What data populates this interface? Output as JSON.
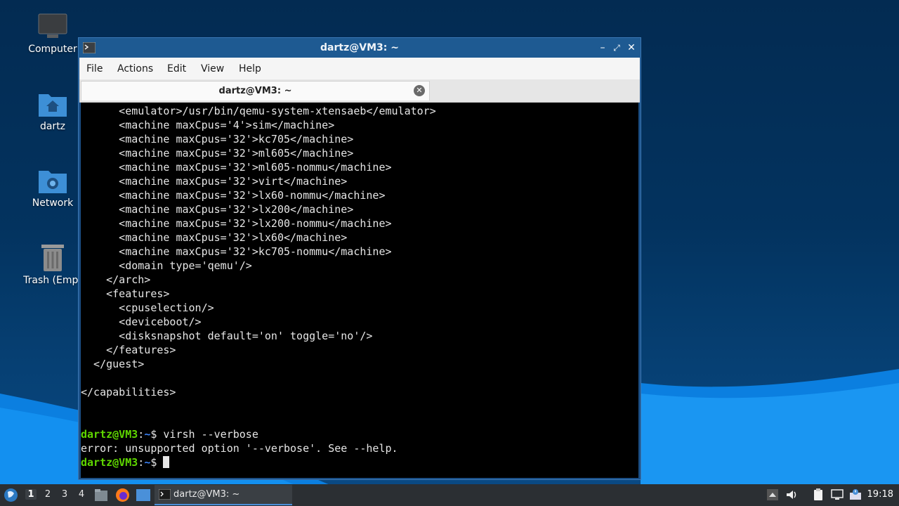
{
  "desktop": {
    "icons": [
      {
        "label": "Computer"
      },
      {
        "label": "dartz"
      },
      {
        "label": "Network"
      },
      {
        "label": "Trash (Empt"
      }
    ]
  },
  "window": {
    "title": "dartz@VM3: ~",
    "menu": [
      "File",
      "Actions",
      "Edit",
      "View",
      "Help"
    ],
    "tab_title": "dartz@VM3: ~"
  },
  "terminal": {
    "lines": [
      "      <emulator>/usr/bin/qemu-system-xtensaeb</emulator>",
      "      <machine maxCpus='4'>sim</machine>",
      "      <machine maxCpus='32'>kc705</machine>",
      "      <machine maxCpus='32'>ml605</machine>",
      "      <machine maxCpus='32'>ml605-nommu</machine>",
      "      <machine maxCpus='32'>virt</machine>",
      "      <machine maxCpus='32'>lx60-nommu</machine>",
      "      <machine maxCpus='32'>lx200</machine>",
      "      <machine maxCpus='32'>lx200-nommu</machine>",
      "      <machine maxCpus='32'>lx60</machine>",
      "      <machine maxCpus='32'>kc705-nommu</machine>",
      "      <domain type='qemu'/>",
      "    </arch>",
      "    <features>",
      "      <cpuselection/>",
      "      <deviceboot/>",
      "      <disksnapshot default='on' toggle='no'/>",
      "    </features>",
      "  </guest>",
      "",
      "</capabilities>",
      "",
      ""
    ],
    "prompt_user": "dartz@VM3",
    "prompt_sep": ":",
    "prompt_path": "~",
    "prompt_symbol": "$",
    "command1": " virsh --verbose",
    "error_line": "error: unsupported option '--verbose'. See --help.",
    "command2": " "
  },
  "taskbar": {
    "workspaces": [
      "1",
      "2",
      "3",
      "4"
    ],
    "active_workspace": "1",
    "task_label": "dartz@VM3: ~",
    "clock": "19:18"
  },
  "colors": {
    "prompt_user": "#5fd700",
    "prompt_path": "#3b82f6",
    "titlebar": "#1e5a92"
  }
}
